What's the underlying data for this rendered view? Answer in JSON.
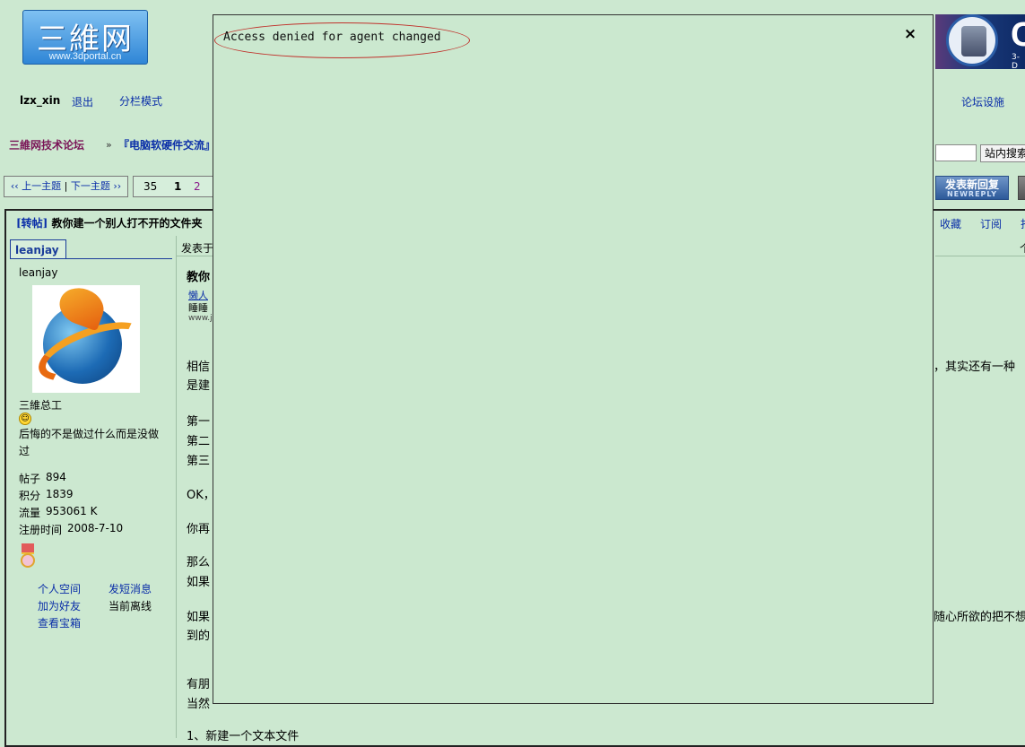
{
  "logo": {
    "chinese": "三維网",
    "url": "www.3dportal.cn"
  },
  "banner": {
    "letter": "C",
    "tag": "3-D"
  },
  "nav": {
    "username": "lzx_xin",
    "logout": "退出",
    "mode": "分栏模式",
    "facilities": "论坛设施"
  },
  "breadcrumb": {
    "home": "三維网技术论坛",
    "separator": "»",
    "section": "『电脑软硬件交流』"
  },
  "search": {
    "button": "站内搜索"
  },
  "threadnav": {
    "prev": "‹‹ 上一主题",
    "sep": "|",
    "next": "下一主题 ››"
  },
  "pager": {
    "total": "35",
    "current": "1",
    "next": "2"
  },
  "reply_button": {
    "label": "发表新回复",
    "sublabel": "NEWREPLY"
  },
  "thread": {
    "prefix": "[转帖]",
    "title": "教你建一个别人打不开的文件夹",
    "favorite": "收藏",
    "subscribe": "订阅",
    "trunc_action": "打",
    "trunc_floor": "个"
  },
  "author": {
    "tab": "leanjay",
    "name": "leanjay",
    "rank": "三維总工",
    "signature": "后悔的不是做过什么而是没做过",
    "stats": [
      {
        "label": "帖子",
        "value": "894"
      },
      {
        "label": "积分",
        "value": "1839"
      },
      {
        "label": "流量",
        "value": "953061 K"
      },
      {
        "label": "注册时间",
        "value": "2008-7-10"
      }
    ],
    "links": {
      "space": "个人空间",
      "message": "发短消息",
      "friend": "加为好友",
      "status": "当前离线",
      "treasure": "查看宝箱"
    }
  },
  "post": {
    "posted_at": "发表于",
    "heading": "教你",
    "source_link": "懒人",
    "source_text": "睡睡",
    "source_url": "www.j",
    "lines": [
      {
        "left": "相信",
        "right": "，其实还有一种"
      },
      {
        "left": "是建",
        "right": ""
      },
      {
        "left": "第一",
        "right": ""
      },
      {
        "left": "第二",
        "right": ""
      },
      {
        "left": "第三",
        "right": ""
      },
      {
        "left": "OK，",
        "right": ""
      },
      {
        "left": "你再",
        "right": ""
      },
      {
        "left": "那么",
        "right": ""
      },
      {
        "left": "如果",
        "right": ""
      },
      {
        "left": "如果",
        "right": "随心所欲的把不想"
      },
      {
        "left": "到的",
        "right": ""
      },
      {
        "left": "有朋",
        "right": ""
      },
      {
        "left": "当然",
        "right": ""
      },
      {
        "left": "1、新建一个文本文件",
        "right": ""
      }
    ]
  },
  "modal": {
    "message": "Access denied for agent changed",
    "close": "×"
  }
}
